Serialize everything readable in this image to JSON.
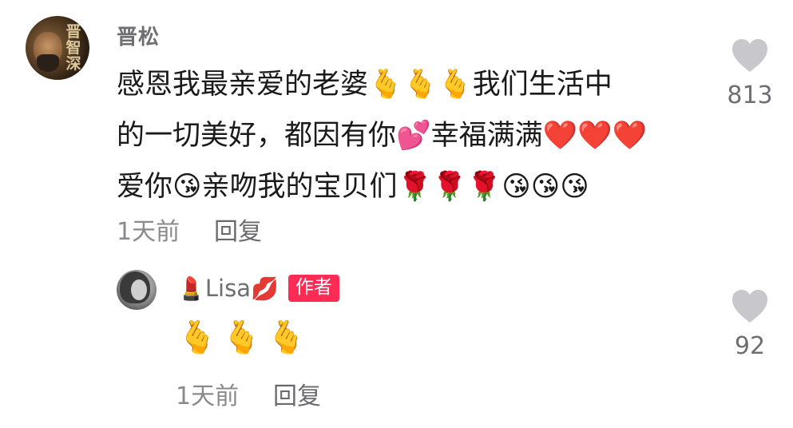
{
  "comment": {
    "username": "晋松",
    "text_line1": "感恩我最亲爱的老婆🫰🫰🫰我们生活中",
    "text_line2": "的一切美好，都因有你💕幸福满满❤️❤️❤️",
    "text_line3": "爱你😘亲吻我的宝贝们🌹🌹🌹😘😘😘",
    "time": "1天前",
    "reply_label": "回复",
    "like_count": "813",
    "avatar_text": "晋智深"
  },
  "reply": {
    "username_prefix_emoji": "💄",
    "username": "Lisa",
    "username_suffix_emoji": "💋",
    "badge": "作者",
    "text": "🫰🫰🫰",
    "time": "1天前",
    "reply_label": "回复",
    "like_count": "92"
  },
  "colors": {
    "badge_bg": "#fe2c55",
    "heart": "#c7c7cc",
    "secondary_text": "#8a8a8e"
  },
  "icons": {
    "like": "heart-icon"
  }
}
